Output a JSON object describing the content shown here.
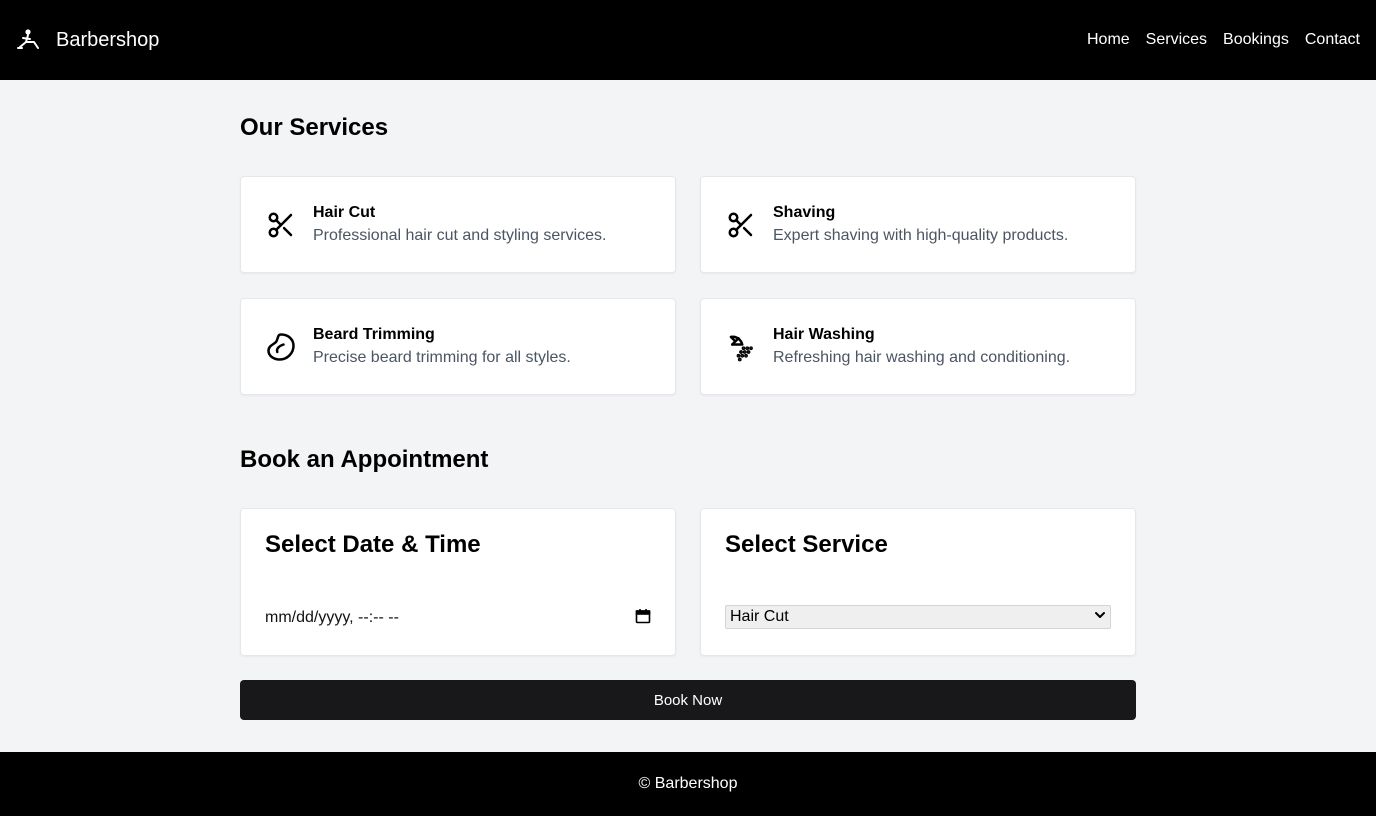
{
  "header": {
    "brand": "Barbershop",
    "brand_icon": "barber-chair-icon",
    "nav": [
      "Home",
      "Services",
      "Bookings",
      "Contact"
    ]
  },
  "services": {
    "title": "Our Services",
    "items": [
      {
        "name": "Hair Cut",
        "desc": "Professional hair cut and styling services.",
        "icon": "scissors-icon"
      },
      {
        "name": "Shaving",
        "desc": "Expert shaving with high-quality products.",
        "icon": "scissors-icon"
      },
      {
        "name": "Beard Trimming",
        "desc": "Precise beard trimming for all styles.",
        "icon": "beard-icon"
      },
      {
        "name": "Hair Washing",
        "desc": "Refreshing hair washing and conditioning.",
        "icon": "shower-icon"
      }
    ]
  },
  "booking": {
    "title": "Book an Appointment",
    "date_card_title": "Select Date & Time",
    "date_placeholder": "mm/dd/yyyy, --:-- --",
    "service_card_title": "Select Service",
    "service_selected": "Hair Cut",
    "button": "Book Now"
  },
  "footer": {
    "text": "© Barbershop"
  }
}
